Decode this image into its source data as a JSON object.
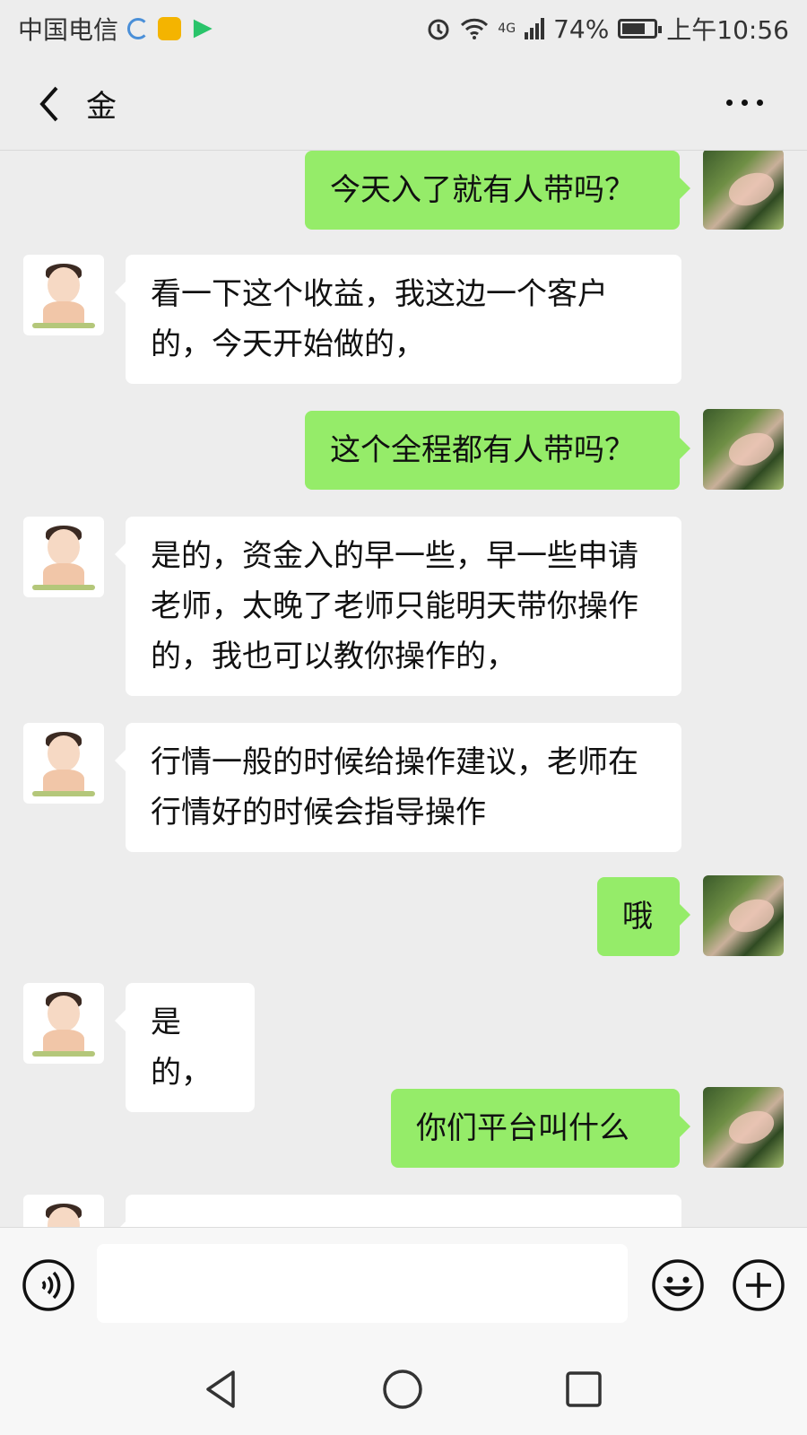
{
  "status_bar": {
    "carrier": "中国电信",
    "network": "4G",
    "battery": "74%",
    "battery_level": 0.74,
    "time": "上午10:56"
  },
  "header": {
    "title": "金",
    "back_icon": "chevron-left-icon",
    "more_icon": "more-dots-icon"
  },
  "messages": [
    {
      "sender": "self",
      "text": "今天入了就有人带吗？"
    },
    {
      "sender": "other",
      "text": "看一下这个收益，我这边一个客户的，今天开始做的，"
    },
    {
      "sender": "self",
      "text": "这个全程都有人带吗？"
    },
    {
      "sender": "other",
      "text": "是的，资金入的早一些，早一些申请老师，太晚了老师只能明天带你操作的，我也可以教你操作的，"
    },
    {
      "sender": "other",
      "text": "行情一般的时候给操作建议，老师在行情好的时候会指导操作"
    },
    {
      "sender": "self",
      "text": "哦"
    },
    {
      "sender": "other",
      "text": "是的，"
    },
    {
      "sender": "self",
      "text": "你们平台叫什么"
    }
  ],
  "input_bar": {
    "value": "",
    "voice_icon": "voice-icon",
    "emoji_icon": "emoji-icon",
    "plus_icon": "plus-icon"
  },
  "colors": {
    "background": "#ededed",
    "self_bubble": "#95ec69",
    "other_bubble": "#ffffff"
  }
}
